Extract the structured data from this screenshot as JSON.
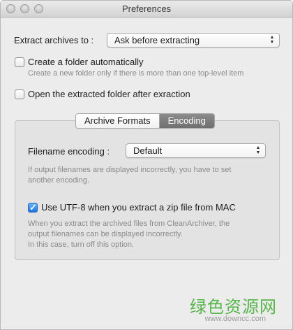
{
  "window": {
    "title": "Preferences"
  },
  "extract": {
    "label": "Extract archives to :",
    "value": "Ask before extracting"
  },
  "create_folder": {
    "label": "Create a folder automatically",
    "checked": false,
    "hint": "Create a new folder only if there is more than one top-level item"
  },
  "open_folder": {
    "label": "Open the extracted folder after exraction",
    "checked": false
  },
  "tabs": [
    {
      "label": "Archive Formats",
      "active": false
    },
    {
      "label": "Encoding",
      "active": true
    }
  ],
  "encoding": {
    "label": "Filename encoding :",
    "value": "Default",
    "hint_line1": "If output filenames are displayed incorrectly, you have to set",
    "hint_line2": "another encoding."
  },
  "utf8": {
    "label": "Use UTF-8 when you extract a zip file from MAC",
    "checked": true,
    "hint_line1": "When you extract the archived files from CleanArchiver, the",
    "hint_line2": "output filenames can be displayed incorrectly.",
    "hint_line3": "In this case, turn off this option."
  },
  "watermark": {
    "text": "绿色资源网",
    "url": "www.downcc.com"
  }
}
